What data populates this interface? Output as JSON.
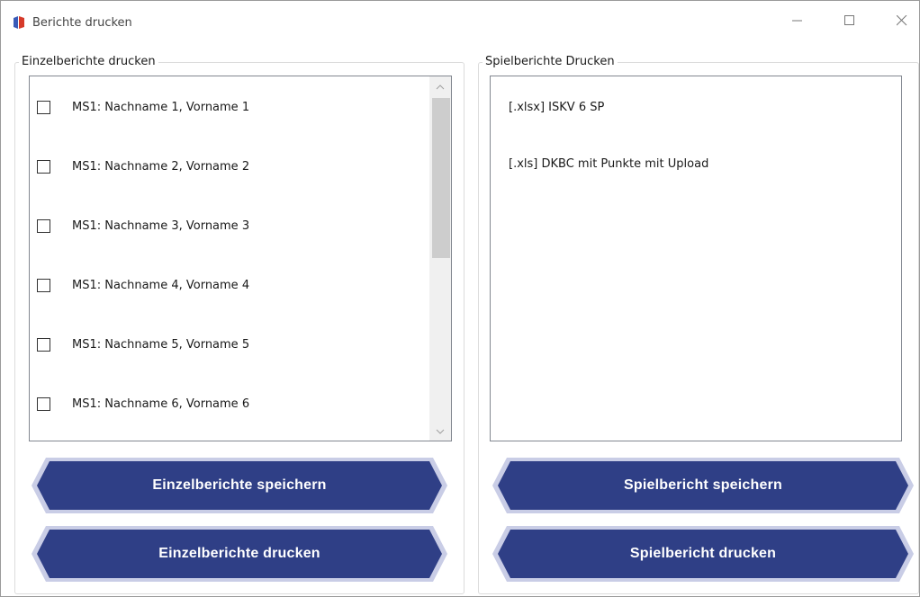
{
  "window": {
    "title": "Berichte drucken",
    "icon": "app-logo-icon",
    "controls": [
      "minimize-icon",
      "maximize-icon",
      "close-icon"
    ]
  },
  "left_group": {
    "title": "Einzelberichte drucken",
    "items": [
      {
        "label": "MS1: Nachname 1, Vorname 1",
        "checked": false
      },
      {
        "label": "MS1: Nachname 2, Vorname 2",
        "checked": false
      },
      {
        "label": "MS1: Nachname 3, Vorname 3",
        "checked": false
      },
      {
        "label": "MS1: Nachname 4, Vorname 4",
        "checked": false
      },
      {
        "label": "MS1: Nachname 5, Vorname 5",
        "checked": false
      },
      {
        "label": "MS1: Nachname 6, Vorname 6",
        "checked": false
      }
    ],
    "save_button": "Einzelberichte speichern",
    "print_button": "Einzelberichte drucken"
  },
  "right_group": {
    "title": "Spielberichte Drucken",
    "items": [
      {
        "label": "[.xlsx] ISKV 6 SP"
      },
      {
        "label": "[.xls] DKBC mit Punkte mit Upload"
      }
    ],
    "save_button": "Spielbericht speichern",
    "print_button": "Spielbericht drucken"
  },
  "colors": {
    "button_fill": "#2f3f86",
    "button_border": "#c9cde6"
  }
}
